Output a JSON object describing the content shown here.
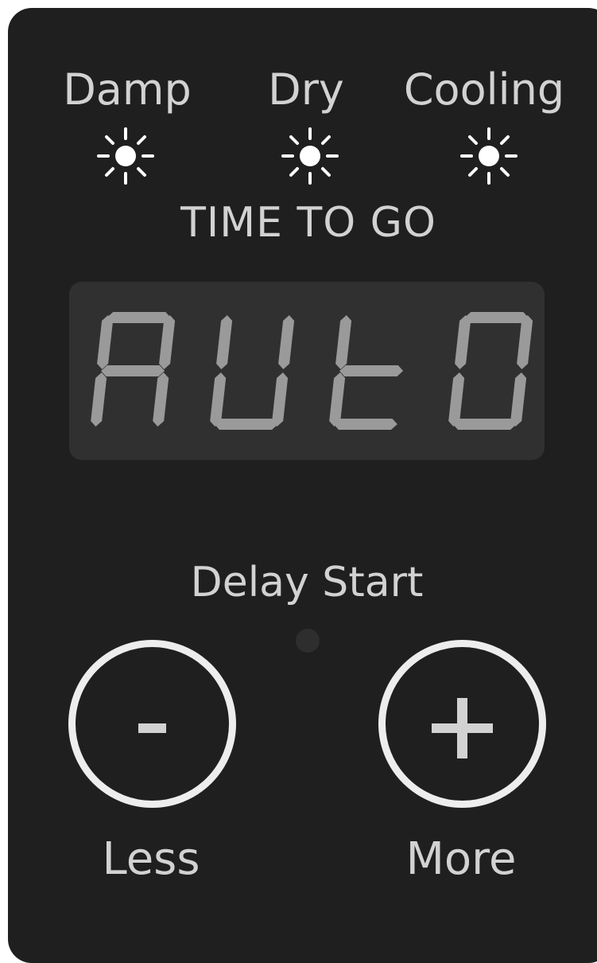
{
  "panel": {
    "status_lights": [
      {
        "label": "Damp",
        "icon": "sun-icon"
      },
      {
        "label": "Dry",
        "icon": "sun-icon"
      },
      {
        "label": "Cooling",
        "icon": "sun-icon"
      }
    ],
    "display_title": "TIME TO GO",
    "display": {
      "text": "AUtO",
      "segment_color": "#9a9a9a",
      "background_color": "#303030"
    },
    "delay_start_label": "Delay Start",
    "buttons": {
      "less": {
        "symbol": "-",
        "label": "Less",
        "icon": "minus-icon"
      },
      "more": {
        "symbol": "+",
        "label": "More",
        "icon": "plus-icon"
      }
    },
    "colors": {
      "panel": "#1f1f1f",
      "text": "#d2d2d2",
      "button_ring": "#ededed"
    }
  }
}
